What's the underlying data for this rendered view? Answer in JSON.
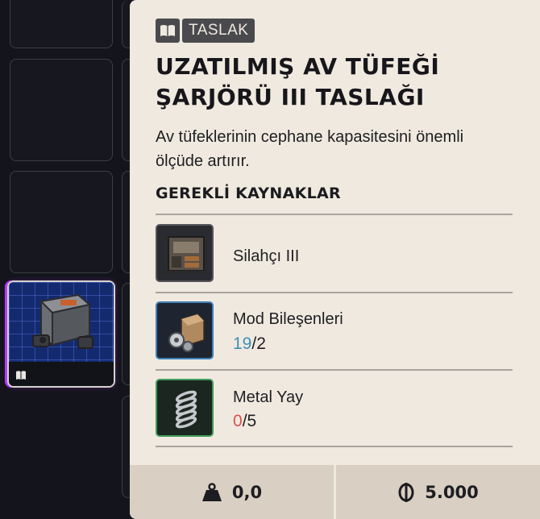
{
  "badge": {
    "label": "TASLAK",
    "icon": "book-icon"
  },
  "item": {
    "title_line1": "UZATILMIŞ AV TÜFEĞİ",
    "title_line2": "ŞARJÖRÜ III TASLAĞI",
    "description": "Av tüfeklerinin cephane kapasitesini önemli ölçüde artırır."
  },
  "requirements": {
    "heading": "GEREKLİ KAYNAKLAR",
    "items": [
      {
        "name": "Silahçı III",
        "icon": "workbench-icon",
        "rarity_color": "#55555a"
      },
      {
        "name": "Mod Bileşenleri",
        "have": "19",
        "need": "2",
        "have_color": "#3f8fb8",
        "icon": "mod-components-icon",
        "rarity_color": "#3d7fb5"
      },
      {
        "name": "Metal Yay",
        "have": "0",
        "need": "5",
        "have_color": "#d9534f",
        "icon": "metal-spring-icon",
        "rarity_color": "#3f9a5a"
      }
    ]
  },
  "footer": {
    "weight": "0,0",
    "weight_icon": "weight-icon",
    "price": "5.000",
    "price_icon": "currency-icon"
  },
  "inventory": {
    "selected_item_icon": "magazine-icon",
    "selected_badge_icon": "book-icon"
  }
}
